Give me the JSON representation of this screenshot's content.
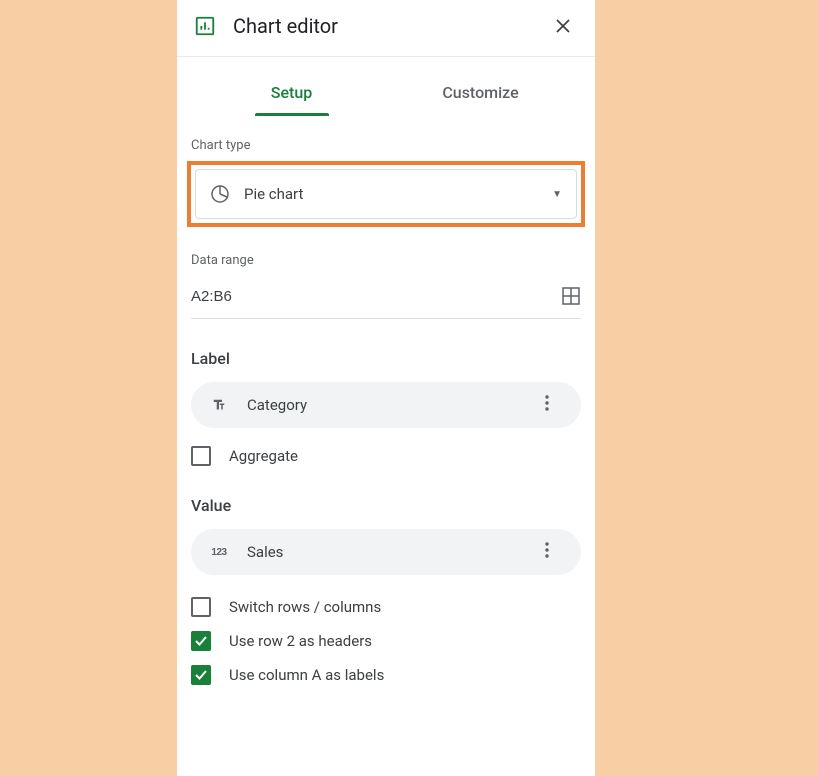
{
  "header": {
    "title": "Chart editor"
  },
  "tabs": {
    "setup": "Setup",
    "customize": "Customize"
  },
  "chartType": {
    "label": "Chart type",
    "value": "Pie chart"
  },
  "dataRange": {
    "label": "Data range",
    "value": "A2:B6"
  },
  "labelSection": {
    "title": "Label",
    "value": "Category",
    "aggregate": {
      "label": "Aggregate",
      "checked": false
    }
  },
  "valueSection": {
    "title": "Value",
    "value": "Sales"
  },
  "options": {
    "switchRows": {
      "label": "Switch rows / columns",
      "checked": false
    },
    "useRowHeaders": {
      "label": "Use row 2 as headers",
      "checked": true
    },
    "useColumnLabels": {
      "label": "Use column A as labels",
      "checked": true
    }
  }
}
